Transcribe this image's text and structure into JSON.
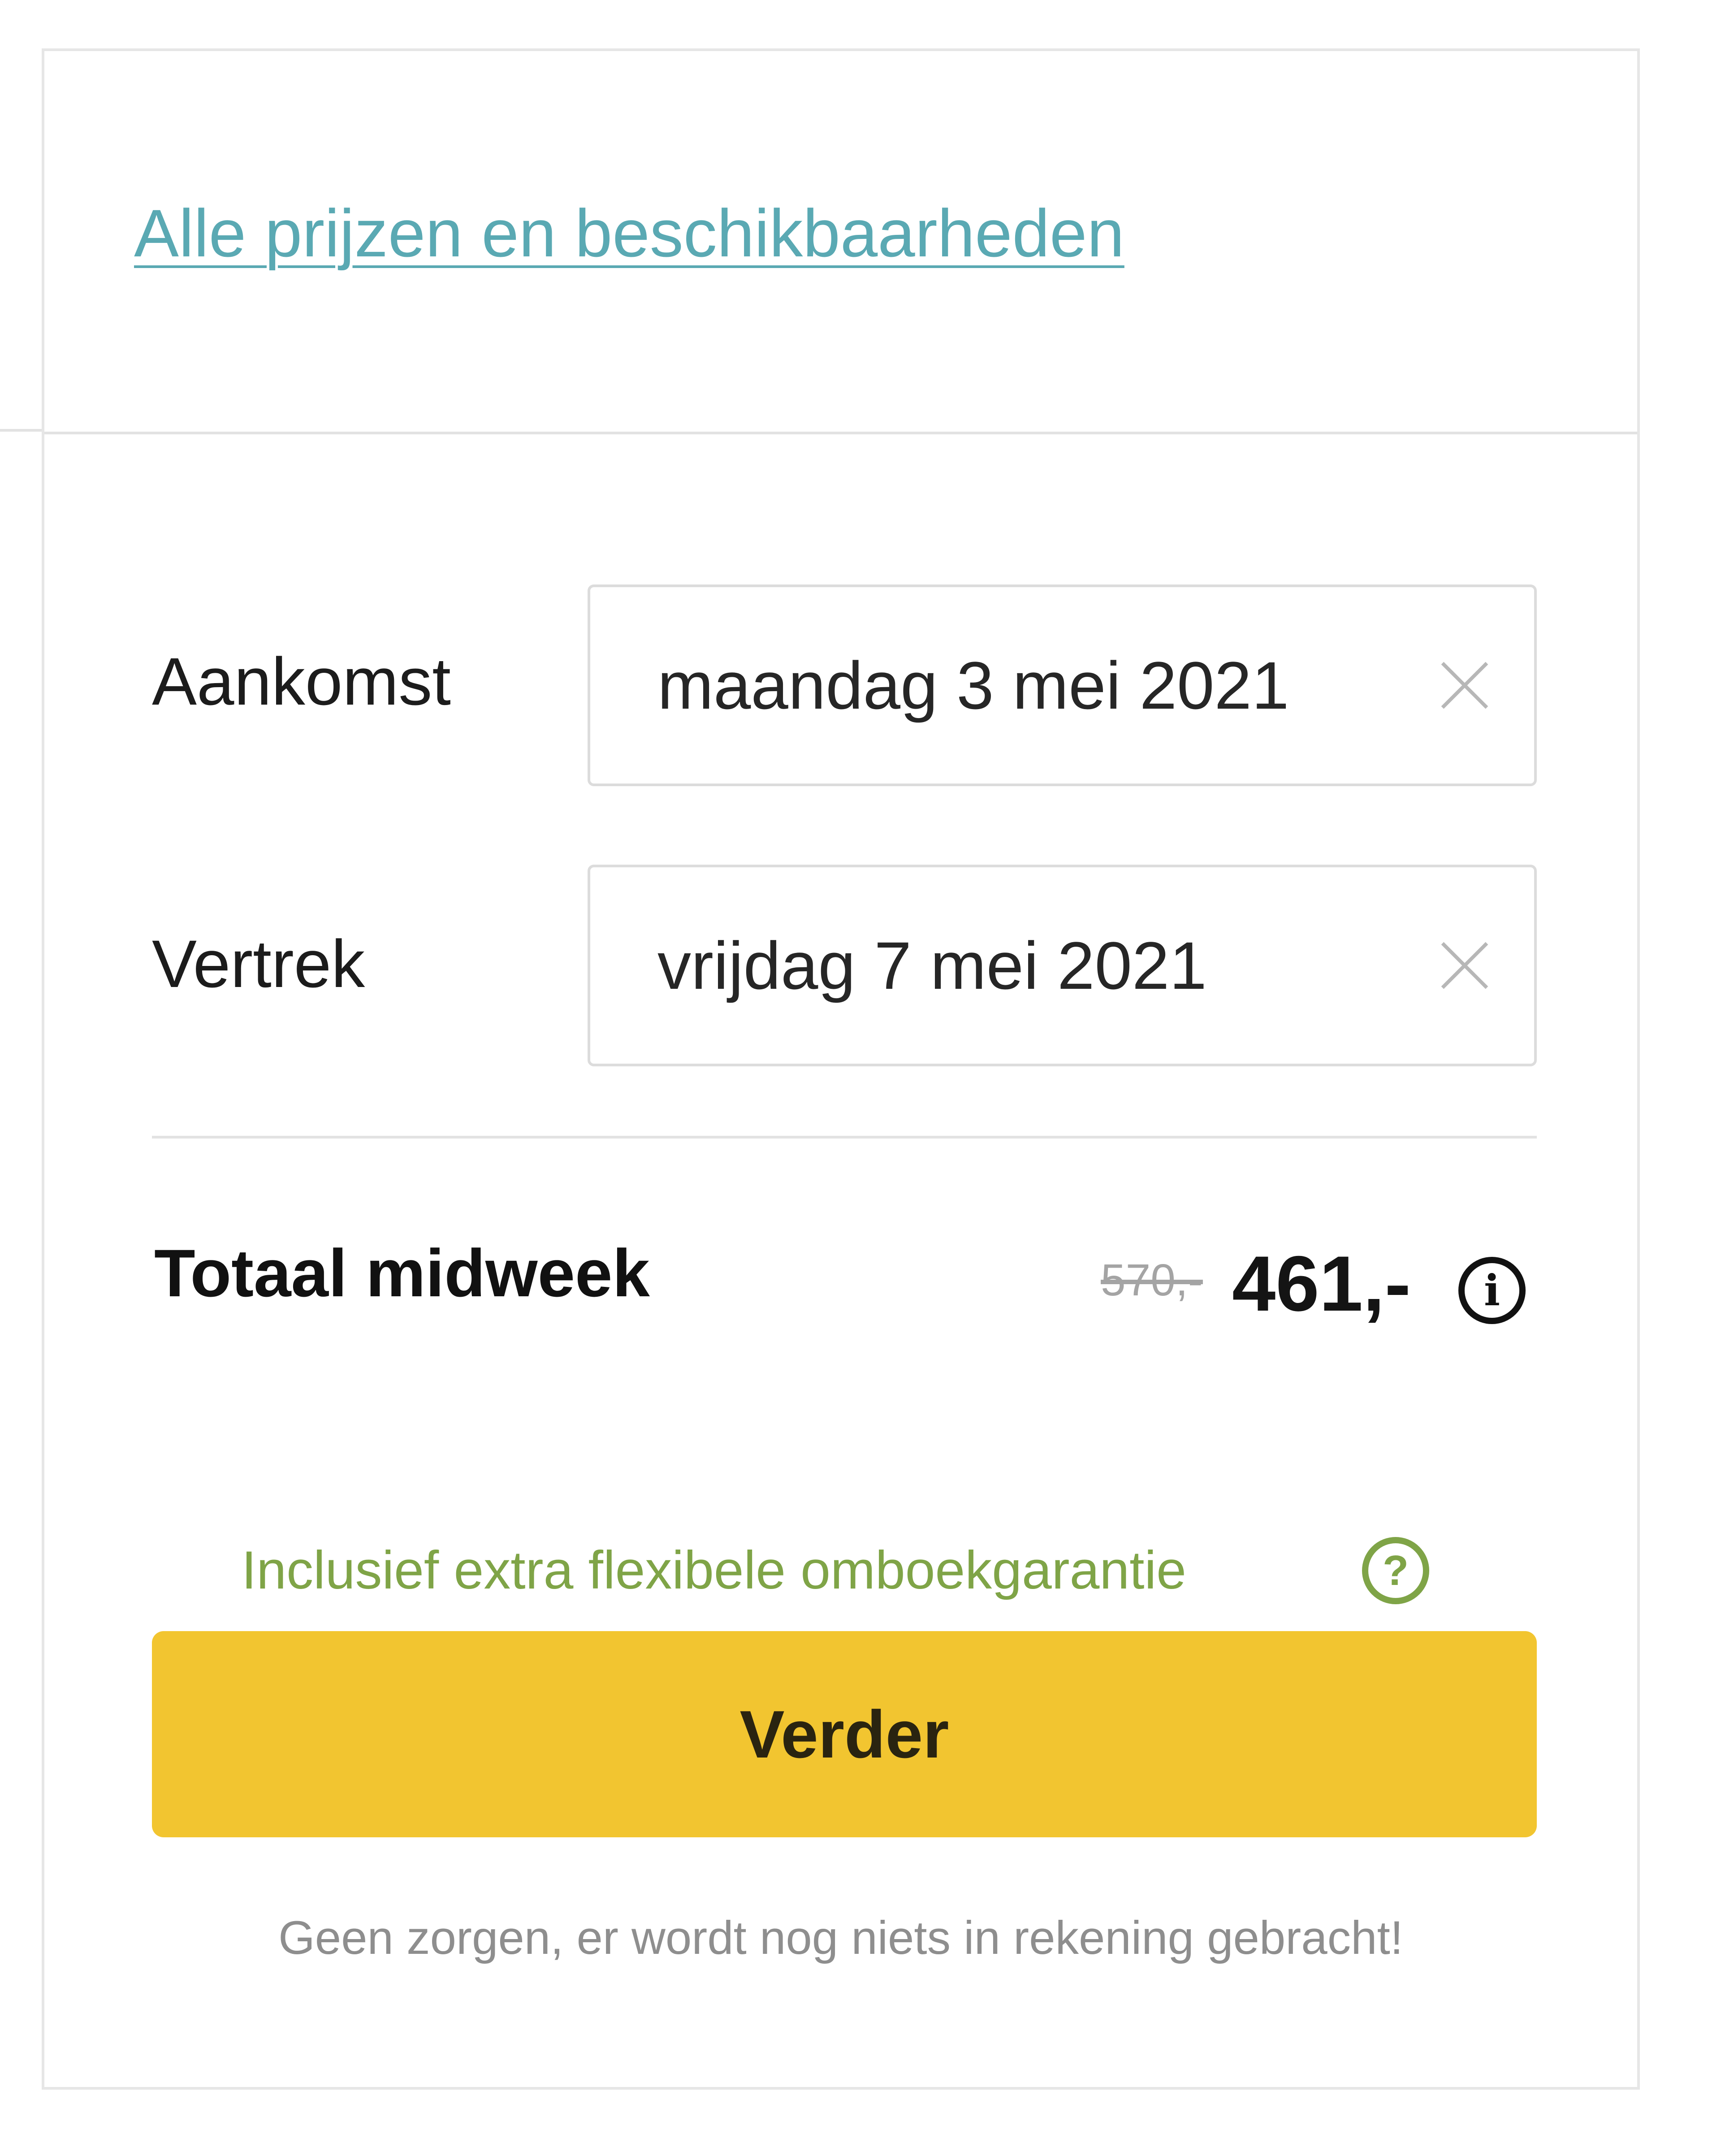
{
  "links": {
    "all_prices": "Alle prijzen en beschikbaarheden"
  },
  "booking": {
    "arrival": {
      "label": "Aankomst",
      "value": "maandag 3 mei 2021"
    },
    "departure": {
      "label": "Vertrek",
      "value": "vrijdag 7 mei 2021"
    }
  },
  "total": {
    "label": "Totaal midweek",
    "old_price": "570,-",
    "price": "461,-",
    "info_glyph": "i"
  },
  "guarantee": {
    "text": "Inclusief extra flexibele omboekgarantie",
    "help_glyph": "?"
  },
  "actions": {
    "continue_label": "Verder"
  },
  "footer": {
    "reassurance": "Geen zorgen, er wordt nog niets in rekening gebracht!"
  },
  "icons": {
    "clear": "close-icon",
    "info": "info-icon",
    "help": "question-icon"
  },
  "colors": {
    "link": "#5aa9b3",
    "button": "#f2c530",
    "guarantee": "#7fa447",
    "strike": "#a4a4a4"
  }
}
